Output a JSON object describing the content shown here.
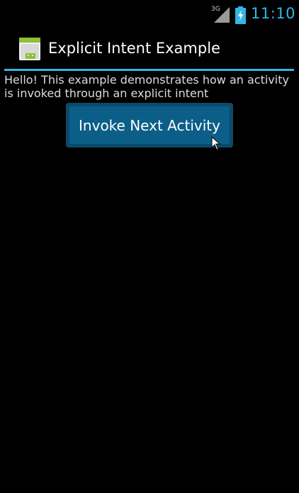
{
  "status_bar": {
    "network": "3G",
    "time": "11:10",
    "accent_color": "#33b5e5",
    "icons": [
      "signal-icon",
      "battery-charging-icon"
    ]
  },
  "action_bar": {
    "title": "Explicit Intent Example",
    "icon": "android-app-icon"
  },
  "content": {
    "message": "Hello! This example demonstrates how an activity is invoked through an explicit intent",
    "button_label": "Invoke Next Activity"
  },
  "colors": {
    "background": "#000000",
    "accent": "#33b5e5",
    "button": "#0b5e88"
  }
}
